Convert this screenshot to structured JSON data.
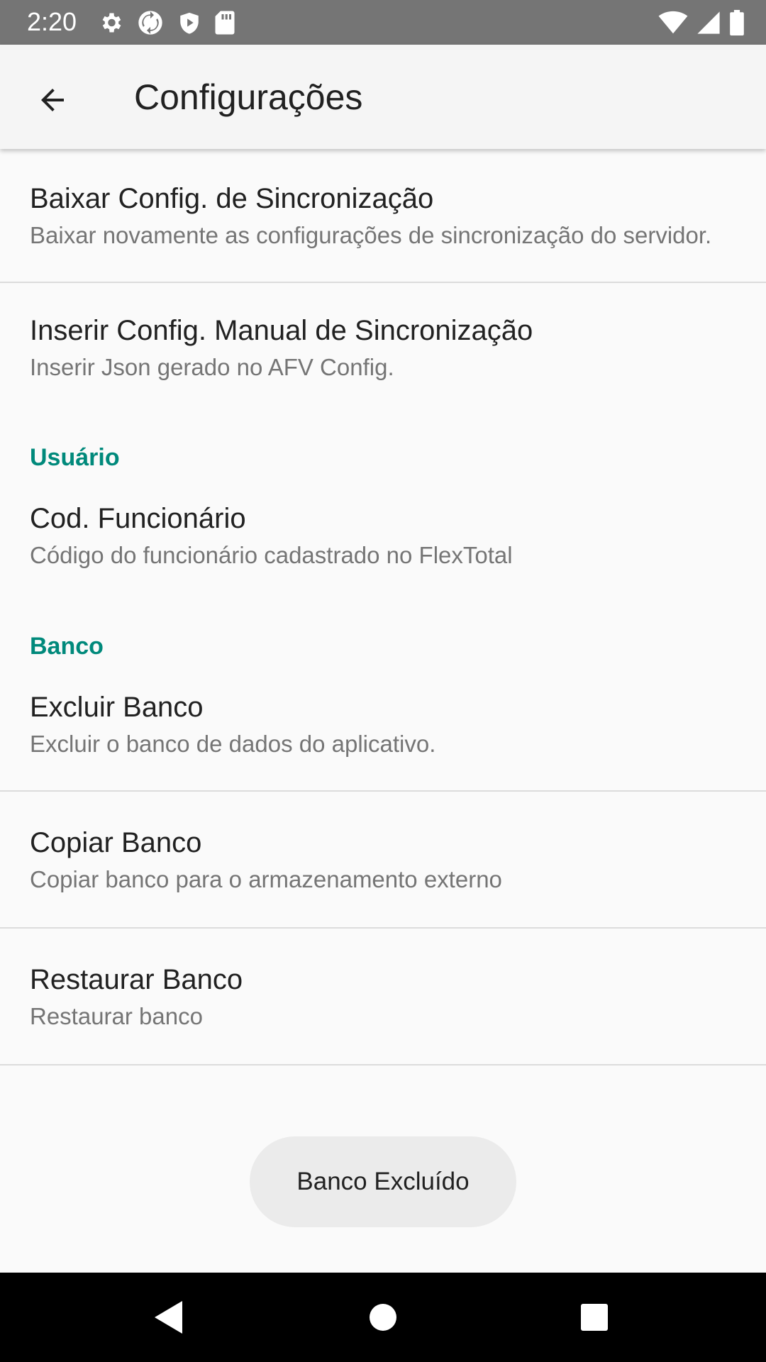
{
  "status_bar": {
    "time": "2:20",
    "left_icons": [
      "settings-icon",
      "sync-icon",
      "shield-play-icon",
      "sd-card-icon"
    ],
    "right_icons": [
      "wifi-icon",
      "signal-icon",
      "battery-icon"
    ]
  },
  "app_bar": {
    "title": "Configurações",
    "back_icon": "arrow-back-icon"
  },
  "preferences": {
    "sync_download": {
      "title": "Baixar Config. de Sincronização",
      "summary": "Baixar novamente as configurações de sincronização do servidor."
    },
    "sync_manual": {
      "title": "Inserir Config. Manual de Sincronização",
      "summary": "Inserir Json gerado no AFV Config."
    },
    "user_category": "Usuário",
    "employee_code": {
      "title": "Cod. Funcionário",
      "summary": "Código do funcionário cadastrado no FlexTotal"
    },
    "database_category": "Banco",
    "delete_db": {
      "title": "Excluir Banco",
      "summary": "Excluir o banco de dados do aplicativo."
    },
    "copy_db": {
      "title": "Copiar Banco",
      "summary": "Copiar banco para o armazenamento externo"
    },
    "restore_db": {
      "title": "Restaurar Banco",
      "summary": "Restaurar banco"
    }
  },
  "toast": {
    "message": "Banco Excluído"
  },
  "colors": {
    "status_bar": "#757575",
    "app_bar": "#f5f5f5",
    "accent": "#00897b",
    "background": "#fafafa",
    "nav_bar": "#000000"
  },
  "nav_bar": {
    "buttons": [
      "nav-back-icon",
      "nav-home-icon",
      "nav-recents-icon"
    ]
  }
}
